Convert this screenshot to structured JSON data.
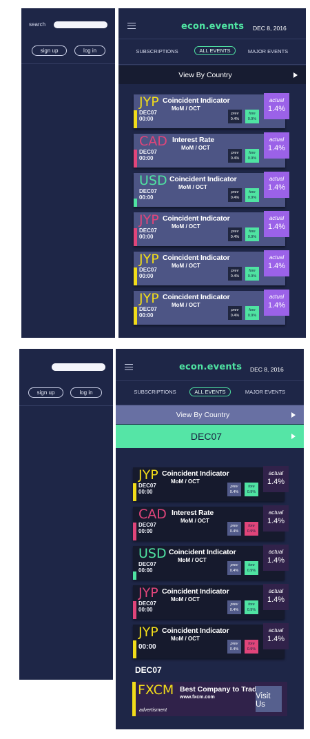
{
  "colors": {
    "panel_bg": "#1e2647",
    "accent_green": "#4fe3a2",
    "yellow": "#f1dc1a",
    "pink": "#e0457a",
    "teal": "#4fe3a2",
    "purple": "#9b62e8",
    "card_blue": "#4d5585",
    "card_dark": "#161a2d"
  },
  "sidebar": {
    "search_label": "search",
    "signup_label": "sign up",
    "login_label": "log in"
  },
  "header": {
    "brand": "econ.events",
    "date": "DEC 8, 2016"
  },
  "tabs": [
    {
      "label": "SUBSCRIPTIONS"
    },
    {
      "label": "ALL EVENTS",
      "active": true
    },
    {
      "label": "MAJOR EVENTS"
    }
  ],
  "view_by_country_label": "View By Country",
  "date_filter_label": "DEC07",
  "section_label": "DEC07",
  "events_top": [
    {
      "currency": "JYP",
      "currency_color": "#f1dc1a",
      "stripe_color": "#f1dc1a",
      "date": "DEC07",
      "time": "00:00",
      "name": "Coincident Indicator",
      "period": "MoM / OCT",
      "prev_label": "prev",
      "prev": "0.4%",
      "fore_label": "fore",
      "fore": "0.9%",
      "actual_label": "actual",
      "actual": "1.4%"
    },
    {
      "currency": "CAD",
      "currency_color": "#e0457a",
      "stripe_color": "#e0457a",
      "date": "DEC07",
      "time": "00:00",
      "name": "Interest Rate",
      "period": "MoM / OCT",
      "prev_label": "prev",
      "prev": "0.4%",
      "fore_label": "fore",
      "fore": "0.9%",
      "actual_label": "actual",
      "actual": "1.4%"
    },
    {
      "currency": "USD",
      "currency_color": "#4fe3a2",
      "stripe_color": "#4fe3a2",
      "date": "DEC07",
      "time": "00:00",
      "name": "Coincident Indicator",
      "period": "MoM / OCT",
      "prev_label": "prev",
      "prev": "0.4%",
      "fore_label": "fore",
      "fore": "0.9%",
      "actual_label": "actual",
      "actual": "1.4%"
    },
    {
      "currency": "JYP",
      "currency_color": "#e0457a",
      "stripe_color": "#e0457a",
      "date": "DEC07",
      "time": "00:00",
      "name": "Coincident Indicator",
      "period": "MoM / OCT",
      "prev_label": "prev",
      "prev": "0.4%",
      "fore_label": "fore",
      "fore": "0.9%",
      "actual_label": "actual",
      "actual": "1.4%"
    },
    {
      "currency": "JYP",
      "currency_color": "#f1dc1a",
      "stripe_color": "#f1dc1a",
      "date": "DEC07",
      "time": "00:00",
      "name": "Coincident Indicator",
      "period": "MoM / OCT",
      "prev_label": "prev",
      "prev": "0.4%",
      "fore_label": "fore",
      "fore": "0.9%",
      "actual_label": "actual",
      "actual": "1.4%"
    },
    {
      "currency": "JYP",
      "currency_color": "#f1dc1a",
      "stripe_color": "#f1dc1a",
      "date": "DEC07",
      "time": "00:00",
      "name": "Coincident Indicator",
      "period": "MoM / OCT",
      "prev_label": "prev",
      "prev": "0.4%",
      "fore_label": "fore",
      "fore": "0.9%",
      "actual_label": "actual",
      "actual": "1.4%"
    }
  ],
  "events_bottom": [
    {
      "currency": "JYP",
      "currency_color": "#f1dc1a",
      "stripe_color": "#f1dc1a",
      "date": "DEC07",
      "time": "00:00",
      "name": "Coincident Indicator",
      "period": "MoM / OCT",
      "prev_label": "prev",
      "prev": "0.4%",
      "fore_label": "fore",
      "fore": "0.9%",
      "fore_color": "#4fe3a2",
      "actual_label": "actual",
      "actual": "1.4%"
    },
    {
      "currency": "CAD",
      "currency_color": "#e0457a",
      "stripe_color": "#e0457a",
      "date": "DEC07",
      "time": "00:00",
      "name": "Interest Rate",
      "period": "MoM / OCT",
      "prev_label": "prev",
      "prev": "0.4%",
      "fore_label": "fore",
      "fore": "0.9%",
      "fore_color": "#e0457a",
      "actual_label": "actual",
      "actual": "1.4%"
    },
    {
      "currency": "USD",
      "currency_color": "#4fe3a2",
      "stripe_color": "#4fe3a2",
      "date": "DEC07",
      "time": "00:00",
      "name": "Coincident Indicator",
      "period": "MoM / OCT",
      "prev_label": "prev",
      "prev": "0.4%",
      "fore_label": "fore",
      "fore": "0.9%",
      "fore_color": "#4fe3a2",
      "actual_label": "actual",
      "actual": "1.4%"
    },
    {
      "currency": "JYP",
      "currency_color": "#e0457a",
      "stripe_color": "#e0457a",
      "date": "DEC07",
      "time": "00:00",
      "name": "Coincident Indicator",
      "period": "MoM / OCT",
      "prev_label": "prev",
      "prev": "0.4%",
      "fore_label": "fore",
      "fore": "0.9%",
      "fore_color": "#4fe3a2",
      "actual_label": "actual",
      "actual": "1.4%"
    },
    {
      "currency": "JYP",
      "currency_color": "#f1dc1a",
      "stripe_color": "#f1dc1a",
      "date": "",
      "time": "00:00",
      "name": "Coincident Indicator",
      "period": "MoM / OCT",
      "prev_label": "prev",
      "prev": "0.4%",
      "fore_label": "fore",
      "fore": "0.9%",
      "fore_color": "#e0457a",
      "actual_label": "actual",
      "actual": "1.4%"
    }
  ],
  "ad": {
    "brand": "FXCM",
    "title": "Best Company to Trade",
    "url": "www.fxcm.com",
    "note": "advertisment",
    "button_label": "Visit Us"
  }
}
